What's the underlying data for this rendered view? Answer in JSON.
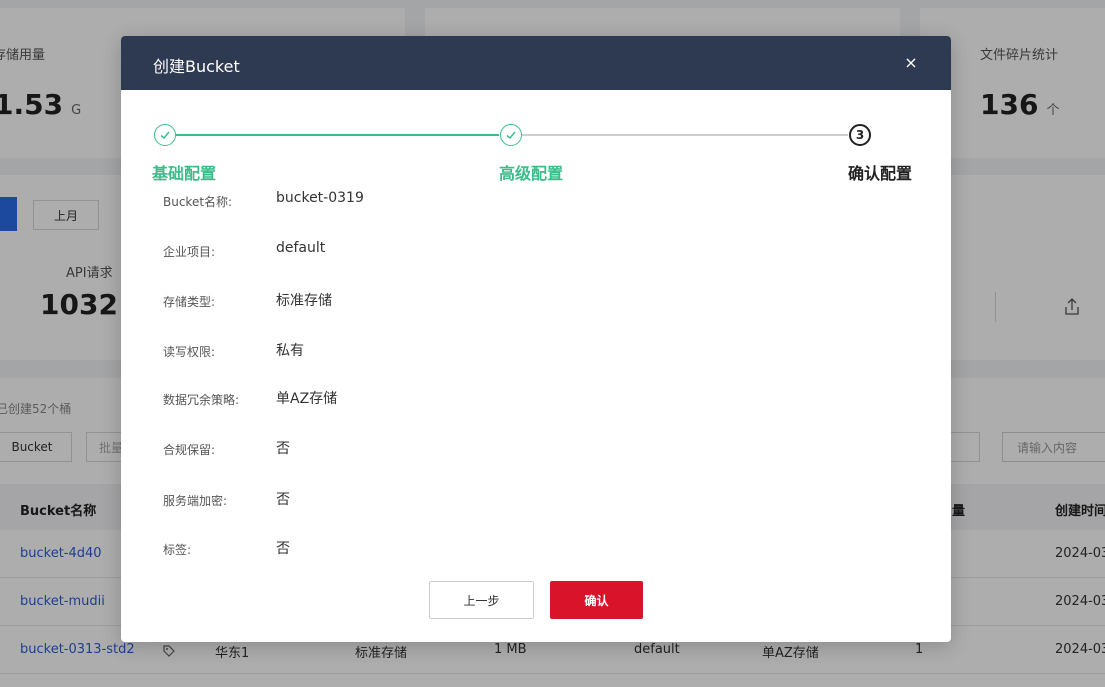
{
  "background": {
    "storage_label": "存储用量",
    "storage_value": "1.53",
    "storage_unit": "G",
    "fragment_label": "文件碎片统计",
    "fragment_value": "136",
    "fragment_unit": "个",
    "last_month_button": "上月",
    "api_label": "API请求（读",
    "api_value": "1032",
    "created_text": "已创建52个桶",
    "create_bucket_button": "Bucket",
    "batch_button": "批量",
    "search_placeholder": "请输入内容",
    "table": {
      "headers": [
        "Bucket名称",
        "量",
        "创建时间"
      ],
      "rows": [
        {
          "name": "bucket-4d40",
          "created": "2024-03"
        },
        {
          "name": "bucket-mudii",
          "created": "2024-03"
        },
        {
          "name": "bucket-0313-std2",
          "region": "华东1",
          "storage_class": "标准存储",
          "size": "1 MB",
          "project": "default",
          "redundancy": "单AZ存储",
          "count": "1",
          "created": "2024-03"
        }
      ]
    }
  },
  "modal": {
    "title": "创建Bucket",
    "close_symbol": "×",
    "steps": [
      {
        "label": "基础配置",
        "status": "done"
      },
      {
        "label": "高级配置",
        "status": "done"
      },
      {
        "label": "确认配置",
        "status": "current",
        "number": "3"
      }
    ],
    "fields": [
      {
        "label": "Bucket名称:",
        "value": "bucket-0319"
      },
      {
        "label": "企业项目:",
        "value": "default"
      },
      {
        "label": "存储类型:",
        "value": "标准存储"
      },
      {
        "label": "读写权限:",
        "value": "私有"
      },
      {
        "label": "数据冗余策略:",
        "value": "单AZ存储"
      },
      {
        "label": "合规保留:",
        "value": "否"
      },
      {
        "label": "服务端加密:",
        "value": "否"
      },
      {
        "label": "标签:",
        "value": "否"
      }
    ],
    "prev_button": "上一步",
    "confirm_button": "确认"
  },
  "colors": {
    "header_bg": "#2e3a52",
    "step_done": "#3bbd8a",
    "confirm_red": "#d9132a",
    "link_blue": "#2a5ed6"
  }
}
